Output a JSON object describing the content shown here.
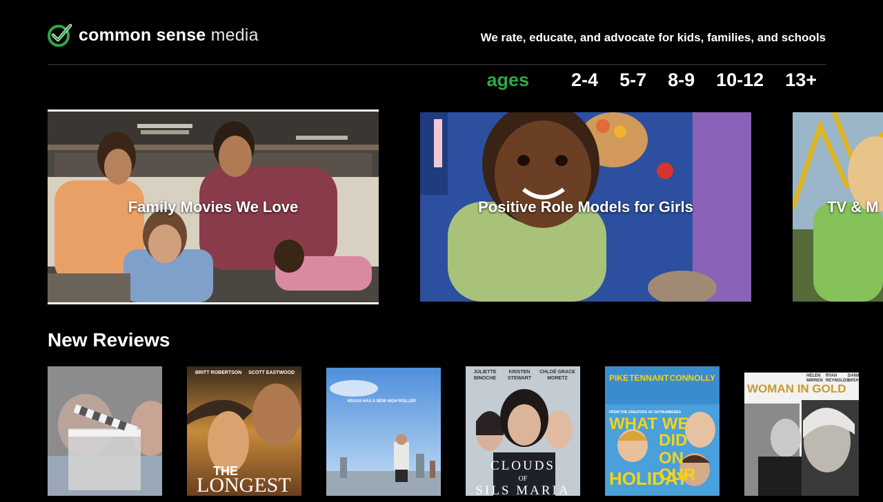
{
  "header": {
    "logo_bold": "common sense",
    "logo_light": "media",
    "tagline": "We rate, educate, and advocate for kids, families, and schools",
    "brand_color": "#2ea84a"
  },
  "ages": {
    "label": "ages",
    "options": [
      "2-4",
      "5-7",
      "8-9",
      "10-12",
      "13+"
    ]
  },
  "carousel": [
    {
      "title": "Family Movies We Love"
    },
    {
      "title": "Positive Role Models for Girls"
    },
    {
      "title": "TV & M"
    }
  ],
  "new_reviews": {
    "heading": "New Reviews",
    "posters": [
      {
        "text": ""
      },
      {
        "credits": [
          "BRITT ROBERTSON",
          "SCOTT EASTWOOD"
        ],
        "title_top": "THE",
        "title_bottom": "LONGEST"
      },
      {
        "tagline": "VEGAS HAS A NEW HIGH ROLLER"
      },
      {
        "credits": [
          "JULIETTE BINOCHE",
          "KRISTEN STEWART",
          "CHLOË GRACE MORETZ"
        ],
        "title": "CLOUDS",
        "of": "OF",
        "title2": "SILS MARIA"
      },
      {
        "credits": [
          "PIKE",
          "TENNANT",
          "CONNOLLY"
        ],
        "from": "FROM THE CREATORS OF OUTNUMBERED",
        "title_lines": [
          "WHAT WE",
          "DID",
          "ON OUR",
          "HOLIDAY"
        ]
      },
      {
        "credits": [
          "HELEN MIRREN",
          "RYAN REYNOLDS",
          "DANIEL BRÜHL"
        ],
        "title": "WOMAN IN GOLD"
      }
    ]
  }
}
